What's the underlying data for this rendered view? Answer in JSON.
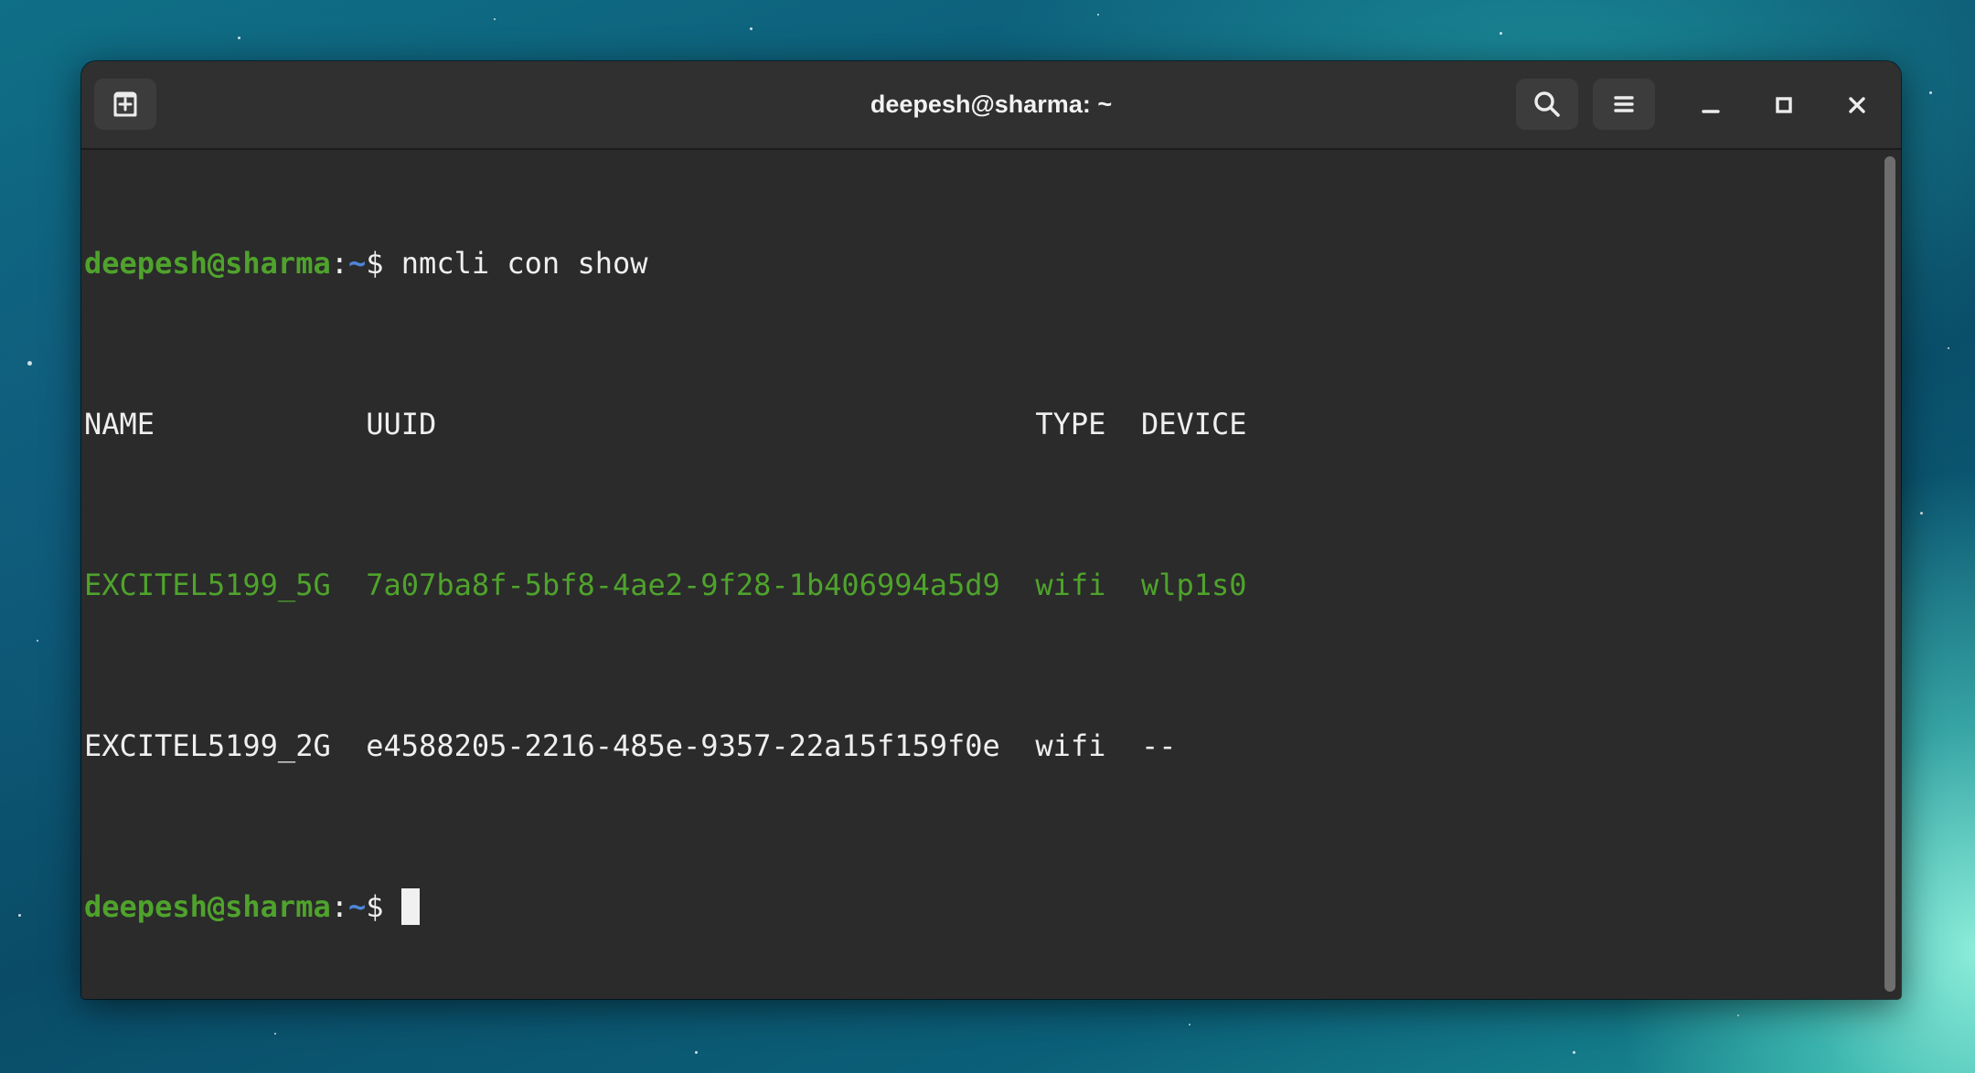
{
  "window": {
    "title": "deepesh@sharma: ~"
  },
  "icons": {
    "new_tab": "new-tab-icon",
    "search": "search-icon",
    "menu": "hamburger-menu-icon",
    "minimize": "minimize-icon",
    "maximize": "maximize-icon",
    "close": "close-icon"
  },
  "colors": {
    "prompt_user": "#4fa32c",
    "prompt_path": "#4d86d8",
    "active_row": "#4fa32c",
    "text": "#efefef",
    "terminal_bg": "#2b2b2b"
  },
  "terminal": {
    "prompt": {
      "user_host": "deepesh@sharma",
      "colon": ":",
      "path": "~",
      "symbol": "$ "
    },
    "command": "nmcli con show",
    "table": {
      "headers": [
        "NAME",
        "UUID",
        "TYPE",
        "DEVICE"
      ],
      "rows": [
        {
          "name": "EXCITEL5199_5G",
          "uuid": "7a07ba8f-5bf8-4ae2-9f28-1b406994a5d9",
          "type": "wifi",
          "device": "wlp1s0",
          "active": true
        },
        {
          "name": "EXCITEL5199_2G",
          "uuid": "e4588205-2216-485e-9357-22a15f159f0e",
          "type": "wifi",
          "device": "--",
          "active": false
        }
      ]
    }
  }
}
